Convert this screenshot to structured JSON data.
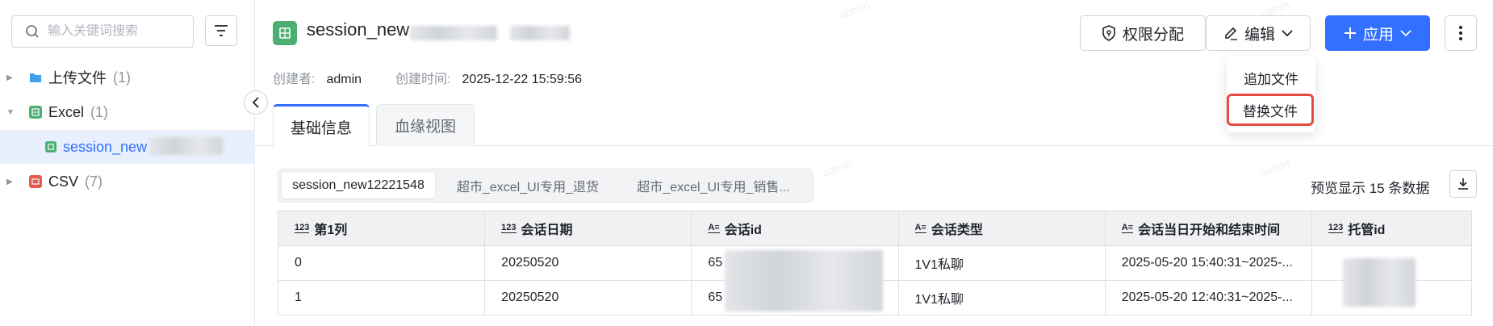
{
  "sidebar": {
    "search_placeholder": "输入关键词搜索",
    "tree": [
      {
        "label": "上传文件",
        "count": "(1)"
      },
      {
        "label": "Excel",
        "count": "(1)"
      },
      {
        "label": "session_new",
        "count": ""
      },
      {
        "label": "CSV",
        "count": "(7)"
      }
    ]
  },
  "header": {
    "title": "session_new",
    "creator_label": "创建者:",
    "creator": "admin",
    "created_label": "创建时间:",
    "created": "2025-12-22 15:59:56",
    "perm_button": "权限分配",
    "edit_button": "编辑",
    "apply_button": "应用"
  },
  "dropdown": {
    "items": [
      "追加文件",
      "替换文件"
    ]
  },
  "tabs": [
    "基础信息",
    "血缘视图"
  ],
  "sheets": [
    "session_new12221548",
    "超市_excel_UI专用_退货",
    "超市_excel_UI专用_销售..."
  ],
  "preview_text": "预览显示 15 条数据",
  "table": {
    "type_icons": [
      "123",
      "123",
      "A≡",
      "A≡",
      "A≡",
      "123"
    ],
    "columns": [
      "第1列",
      "会话日期",
      "会话id",
      "会话类型",
      "会话当日开始和结束时间",
      "托管id"
    ],
    "rows": [
      [
        "0",
        "20250520",
        "65",
        "1V1私聊",
        "2025-05-20 15:40:31~2025-...",
        ""
      ],
      [
        "1",
        "20250520",
        "65",
        "1V1私聊",
        "2025-05-20 12:40:31~2025-...",
        ""
      ]
    ]
  },
  "watermark": "admin",
  "colors": {
    "accent": "#3370ff",
    "excel": "#4caf71",
    "csv": "#e5594f",
    "highlight": "#e34a43"
  }
}
